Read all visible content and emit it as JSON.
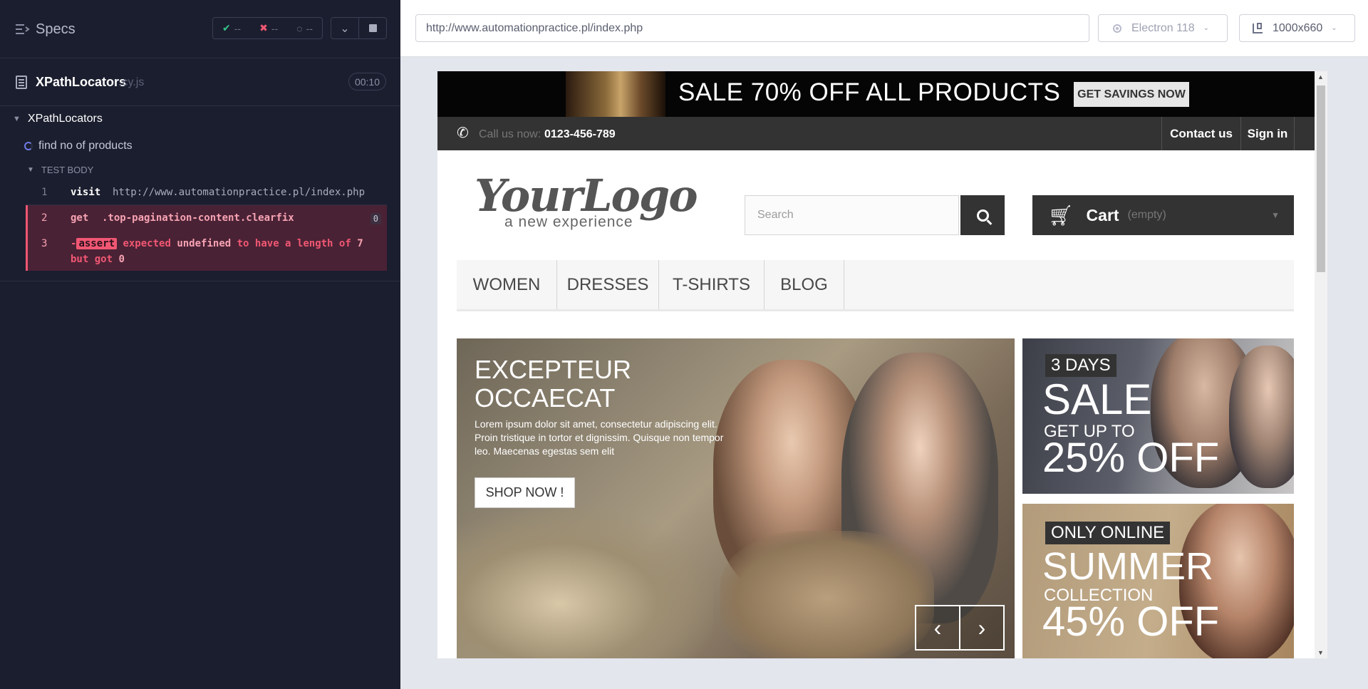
{
  "specs": {
    "title": "Specs",
    "stats": {
      "passed": "--",
      "failed": "--",
      "pending": "--"
    }
  },
  "file": {
    "name": "XPathLocators",
    "ext": ".cy.js",
    "duration": "00:10"
  },
  "suite": {
    "name": "XPathLocators"
  },
  "test": {
    "name": "find no of products"
  },
  "test_body_label": "TEST BODY",
  "commands": [
    {
      "num": "1",
      "name": "visit",
      "message": "http://www.automationpractice.pl/index.php"
    },
    {
      "num": "2",
      "name": "get",
      "message": ".top-pagination-content.clearfix",
      "badge": "0"
    },
    {
      "num": "3",
      "name": "assert",
      "prefix": "-",
      "w1": "expected",
      "w2": "undefined",
      "w3": "to have a length of",
      "w4": "7",
      "w5": "but got",
      "w6": "0"
    }
  ],
  "browser_bar": {
    "url": "http://www.automationpractice.pl/index.php",
    "browser": "Electron 118",
    "viewport": "1000x660"
  },
  "site": {
    "banner": {
      "text": "SALE 70% OFF ALL PRODUCTS",
      "button": "GET SAVINGS NOW"
    },
    "infobar": {
      "call_label": "Call us now:",
      "phone": "0123-456-789",
      "contact": "Contact us",
      "signin": "Sign in"
    },
    "logo": {
      "main": "YourLogo",
      "sub": "a new experience"
    },
    "search": {
      "placeholder": "Search"
    },
    "cart": {
      "label": "Cart",
      "status": "(empty)"
    },
    "menu": [
      "WOMEN",
      "DRESSES",
      "T-SHIRTS",
      "BLOG"
    ],
    "slider": {
      "title": "EXCEPTEUR OCCAECAT",
      "text": "Lorem ipsum dolor sit amet, consectetur adipiscing elit. Proin tristique in tortor et dignissim. Quisque non tempor leo. Maecenas egestas sem elit",
      "button": "SHOP NOW !"
    },
    "promo1": {
      "badge": "3 DAYS",
      "big": "SALE",
      "sub": "GET UP TO",
      "pct": "25% OFF"
    },
    "promo2": {
      "badge": "ONLY ONLINE",
      "big": "SUMMER",
      "sub": "COLLECTION",
      "pct": "45% OFF"
    }
  },
  "colors": {
    "sidebar_bg": "#1b1e2e",
    "fail": "#f15773",
    "pass": "#34c88c",
    "accent_spinner": "#6f7ce5"
  },
  "icons": [
    "specs-list-icon",
    "check-icon",
    "x-icon",
    "spinner-icon",
    "chevron-down-icon",
    "stop-icon",
    "file-icon",
    "gear-icon",
    "viewport-icon",
    "phone-icon",
    "search-icon",
    "cart-icon",
    "chevron-left-icon",
    "chevron-right-icon"
  ]
}
